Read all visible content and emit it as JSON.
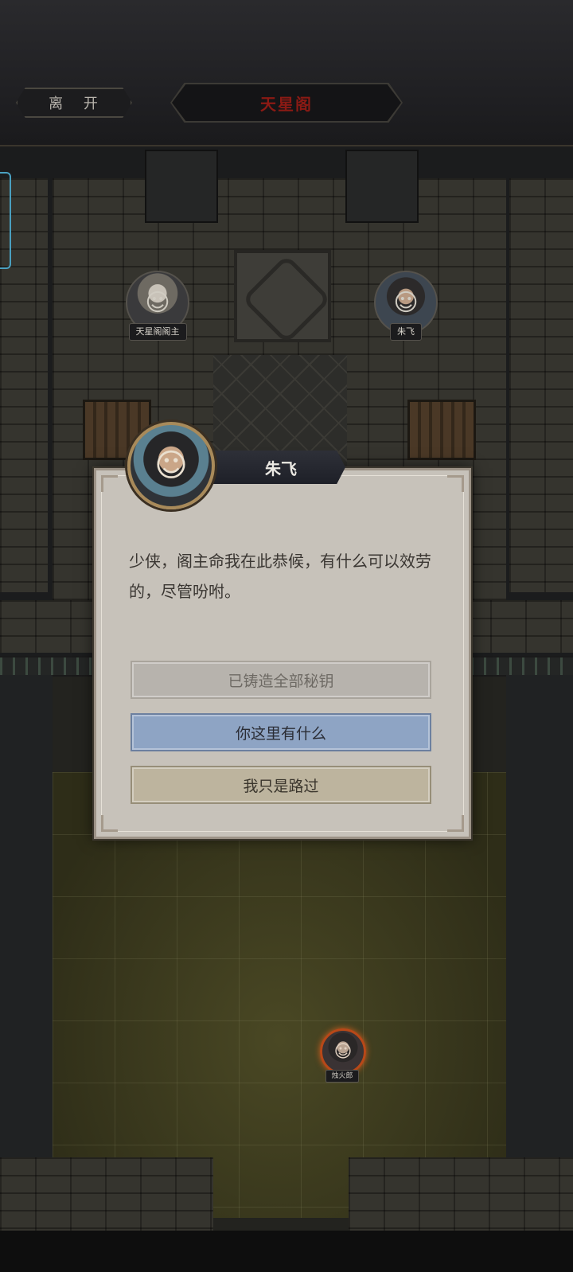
{
  "header": {
    "leave_label": "离 开",
    "location_title": "天星阁",
    "title_color": "#8b1a14"
  },
  "map": {
    "npcs": [
      {
        "name": "天星阁阁主",
        "icon": "npc-portrait-icon"
      },
      {
        "name": "朱飞",
        "icon": "npc-portrait-icon"
      }
    ],
    "player": {
      "name": "烛火郎",
      "icon": "player-portrait-icon"
    }
  },
  "dialog": {
    "speaker": "朱飞",
    "text": "少侠，阁主命我在此恭候，有什么可以效劳的，尽管吩咐。",
    "options": [
      {
        "label": "已铸造全部秘钥",
        "state": "disabled"
      },
      {
        "label": "你这里有什么",
        "state": "highlighted"
      },
      {
        "label": "我只是路过",
        "state": "normal"
      }
    ]
  }
}
